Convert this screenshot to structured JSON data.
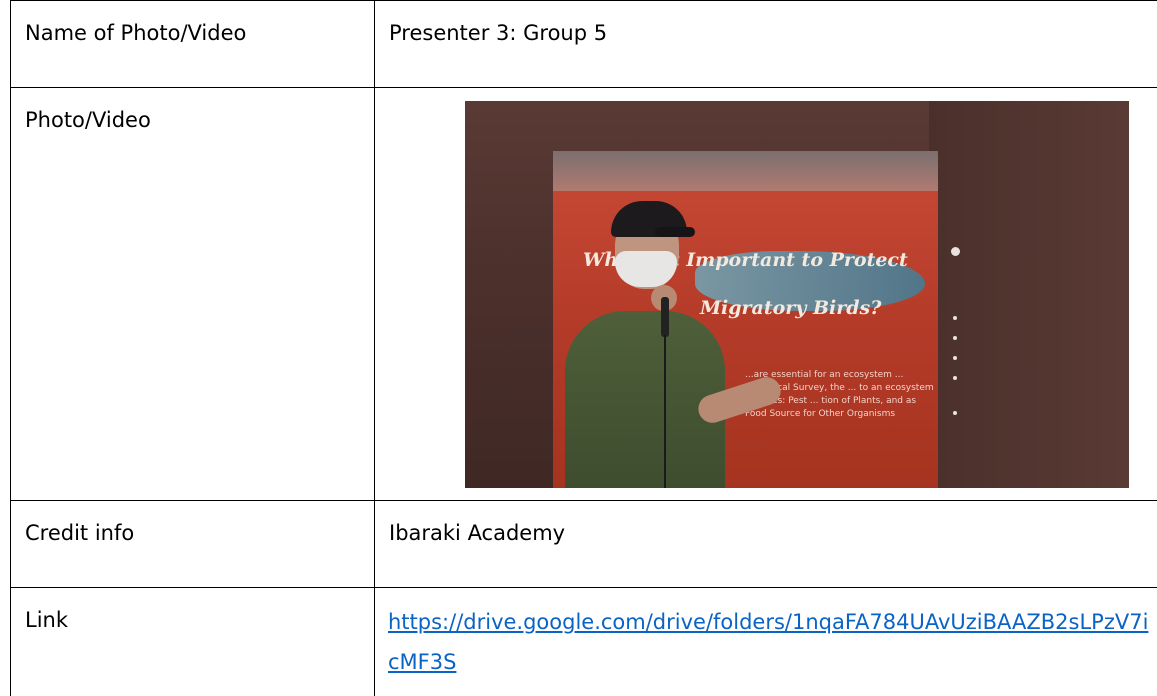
{
  "table": {
    "rows": [
      {
        "label": "Name of Photo/Video",
        "value": "Presenter 3: Group 5"
      },
      {
        "label": "Photo/Video"
      },
      {
        "label": "Credit info",
        "value": "Ibaraki Academy"
      },
      {
        "label": "Link",
        "value": "https://drive.google.com/drive/folders/1nqaFA784UAvUziBAAZB2sLPzV7icMF3S"
      }
    ]
  },
  "photo": {
    "slide_title_line1": "Why Is It Important to Protect",
    "slide_title_line2": "Migratory Birds?",
    "slide_body": "...are essential for an ecosystem ... ecological Survey, the ... to an ecosystem includes: Pest ... tion of Plants, and as Food Source for Other Organisms",
    "colors": {
      "slide_red": "#c84a36",
      "shirt_green": "#4e5f3a",
      "link_blue": "#0b63c5"
    }
  }
}
